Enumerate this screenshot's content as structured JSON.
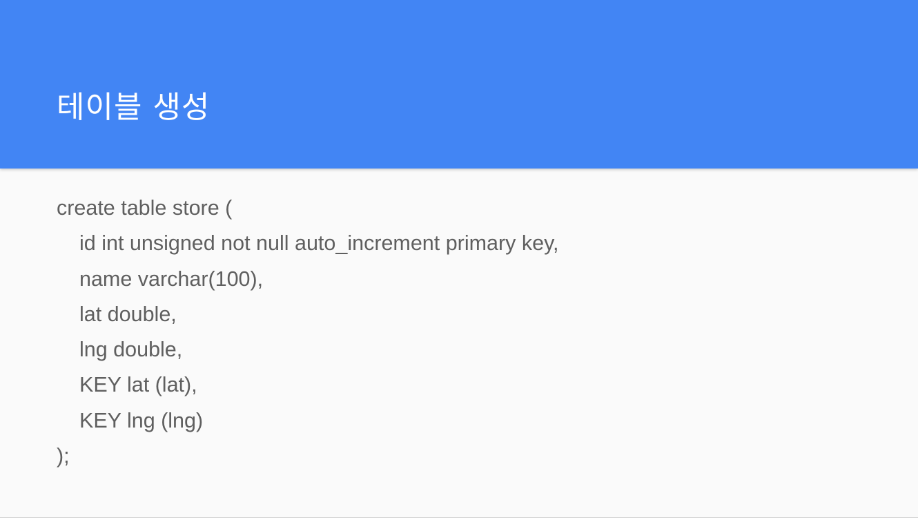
{
  "slide": {
    "title": "테이블 생성",
    "code": {
      "line_1": "create table store (",
      "line_2": "id int unsigned not null auto_increment primary key,",
      "line_3": "name varchar(100),",
      "line_4": "lat double,",
      "line_5": "lng double,",
      "line_6": "KEY lat (lat),",
      "line_7": "KEY lng (lng)",
      "line_8": ");"
    },
    "colors": {
      "header": "#4285f4",
      "background": "#fafafa",
      "title_text": "#ffffff",
      "body_text": "#5f5f5f"
    }
  }
}
